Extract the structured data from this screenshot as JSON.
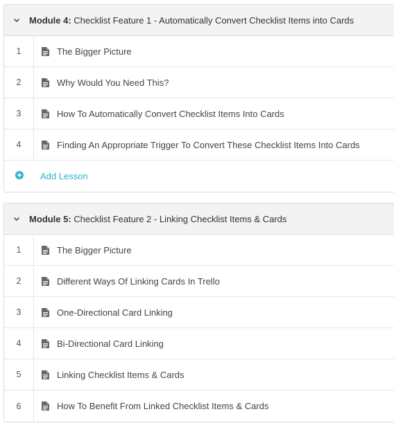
{
  "colors": {
    "accent": "#2bb1c9",
    "header_bg": "#f3f3f3",
    "border": "#dcdcdc",
    "text": "#444444"
  },
  "icons": {
    "collapse": "chevron-down-icon",
    "lesson": "document-icon",
    "add": "plus-circle-icon"
  },
  "modules": [
    {
      "label": "Module 4:",
      "title": "Checklist Feature 1 - Automatically Convert Checklist Items into Cards",
      "lessons": [
        {
          "num": "1",
          "title": "The Bigger Picture"
        },
        {
          "num": "2",
          "title": "Why Would You Need This?"
        },
        {
          "num": "3",
          "title": "How To Automatically Convert Checklist Items Into Cards"
        },
        {
          "num": "4",
          "title": "Finding An Appropriate Trigger To Convert These Checklist Items Into Cards"
        }
      ],
      "add_lesson_label": "Add Lesson"
    },
    {
      "label": "Module 5:",
      "title": "Checklist Feature 2 - Linking Checklist Items & Cards",
      "lessons": [
        {
          "num": "1",
          "title": "The Bigger Picture"
        },
        {
          "num": "2",
          "title": "Different Ways Of Linking Cards In Trello"
        },
        {
          "num": "3",
          "title": "One-Directional Card Linking"
        },
        {
          "num": "4",
          "title": "Bi-Directional Card Linking"
        },
        {
          "num": "5",
          "title": "Linking Checklist Items & Cards"
        },
        {
          "num": "6",
          "title": "How To Benefit From Linked Checklist Items & Cards"
        }
      ]
    }
  ]
}
